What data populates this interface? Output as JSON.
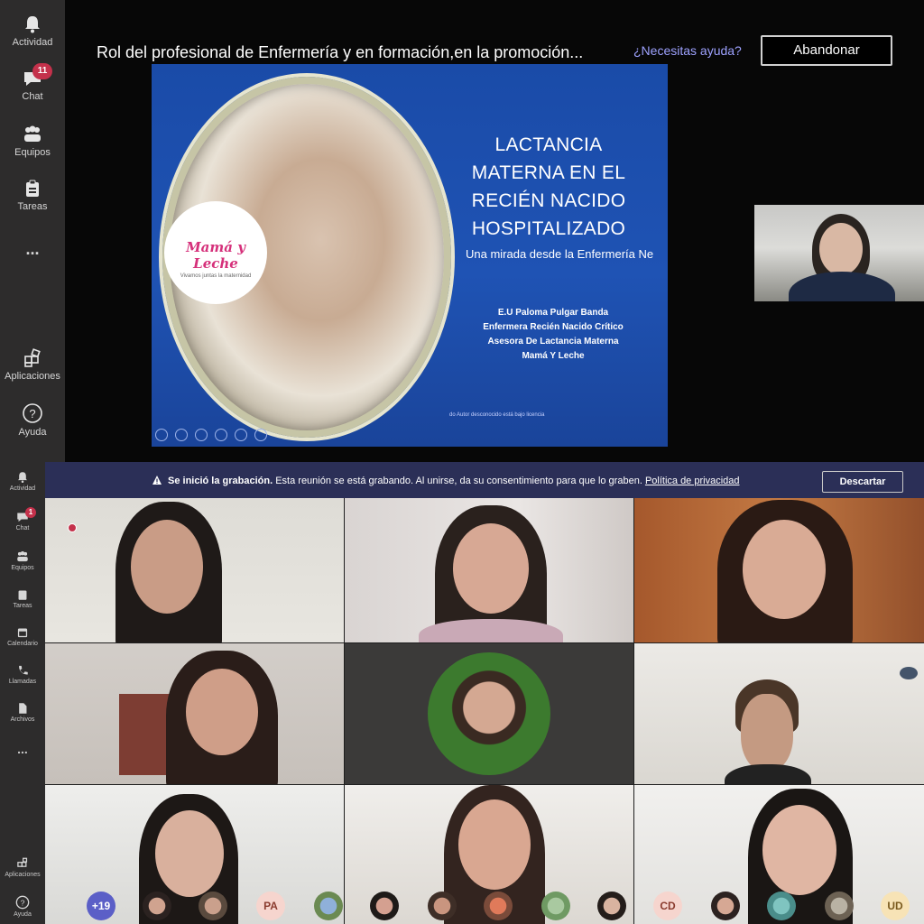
{
  "top": {
    "rail": [
      {
        "label": "Actividad",
        "icon": "bell-icon"
      },
      {
        "label": "Chat",
        "icon": "chat-icon",
        "badge": "11"
      },
      {
        "label": "Equipos",
        "icon": "teams-icon"
      },
      {
        "label": "Tareas",
        "icon": "tasks-icon"
      },
      {
        "label": "...",
        "icon": "more-icon"
      },
      {
        "label": "Aplicaciones",
        "icon": "apps-icon"
      },
      {
        "label": "Ayuda",
        "icon": "help-icon"
      }
    ],
    "meeting_title": "Rol del profesional de Enfermería y en formación,en la promoción...",
    "help_link": "¿Necesitas ayuda?",
    "leave_button": "Abandonar",
    "slide": {
      "logo_brand": "Mamá y Leche",
      "logo_tagline": "Vivamos juntas la maternidad",
      "title_lines": [
        "LACTANCIA",
        "MATERNA EN  EL",
        "RECIÉN NACIDO",
        "HOSPITALIZADO"
      ],
      "subtitle": "Una mirada desde la Enfermería Ne",
      "credits": [
        "E.U Paloma Pulgar Banda",
        "Enfermera Recién Nacido  Crítico",
        "Asesora De Lactancia Materna",
        "Mamá Y Leche"
      ],
      "footnote": "do Autor desconocido está bajo licencia"
    }
  },
  "bottom": {
    "rail": [
      {
        "label": "Actividad",
        "icon": "bell-icon"
      },
      {
        "label": "Chat",
        "icon": "chat-icon",
        "badge": "1"
      },
      {
        "label": "Equipos",
        "icon": "teams-icon"
      },
      {
        "label": "Tareas",
        "icon": "tasks-icon"
      },
      {
        "label": "Calendario",
        "icon": "calendar-icon"
      },
      {
        "label": "Llamadas",
        "icon": "phone-icon"
      },
      {
        "label": "Archivos",
        "icon": "files-icon"
      },
      {
        "label": "...",
        "icon": "more-icon"
      },
      {
        "label": "Aplicaciones",
        "icon": "apps-icon"
      },
      {
        "label": "Ayuda",
        "icon": "help-icon"
      }
    ],
    "banner": {
      "bold": "Se inició la grabación.",
      "text": " Esta reunión se está grabando. Al unirse, da su consentimiento para que lo graben. ",
      "link": "Política de privacidad",
      "dismiss": "Descartar"
    },
    "strip": {
      "overflow_count": "+19",
      "initials": [
        "PA",
        "CD",
        "UD"
      ]
    }
  },
  "colors": {
    "rail_bg": "#2d2c2c",
    "slide_blue": "#1f53b4",
    "banner_bg": "#2b2f57",
    "badge_red": "#c4314b",
    "link_purple": "#9ea2ff"
  }
}
